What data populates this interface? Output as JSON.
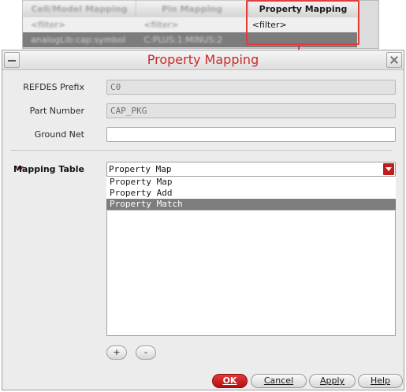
{
  "background_grid": {
    "columns": [
      "Cell/Model Mapping",
      "Pin Mapping",
      "Property Mapping"
    ],
    "row1": [
      "<filter>",
      "<filter>",
      "<filter>"
    ],
    "row2": [
      "analogLib:cap:symbol",
      "C:PLUS:1:MINUS:2",
      ""
    ]
  },
  "annotation": {
    "color": "#e53b3b"
  },
  "dialog": {
    "title": "Property Mapping",
    "title_color": "#cc2929",
    "minimize_icon": "minimize-icon",
    "close_icon": "close-icon",
    "fields": {
      "refdes_label": "REFDES Prefix",
      "refdes_value": "C0",
      "part_number_label": "Part Number",
      "part_number_value": "CAP_PKG",
      "ground_net_label": "Ground Net",
      "ground_net_value": ""
    },
    "mapping_table": {
      "label": "Mapping Table",
      "selected": "Property Map",
      "options": [
        "Property Map",
        "Property Add",
        "Property Match"
      ],
      "highlighted_option": "Property Match"
    },
    "row_buttons": {
      "add": "+",
      "remove": "-"
    },
    "footer": {
      "ok": "OK",
      "cancel": "Cancel",
      "apply": "Apply",
      "help": "Help"
    },
    "accent_color": "#c21d1d"
  }
}
